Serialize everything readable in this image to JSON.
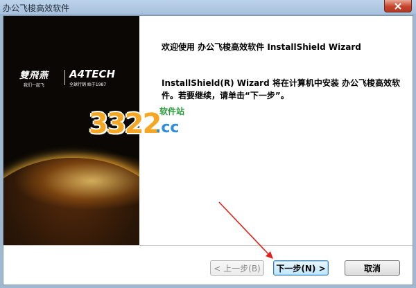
{
  "window": {
    "title": "办公飞梭高效软件"
  },
  "banner": {
    "brand_cn": "雙飛燕",
    "brand_cn_sub": "我们一起飞",
    "brand_en": "A4TECH",
    "brand_en_sub": "全球行销  始于1987"
  },
  "content": {
    "heading": "欢迎使用 办公飞梭高效软件 InstallShield Wizard",
    "body": "InstallShield(R) Wizard 将在计算机中安装 办公飞梭高效软件。若要继续，请单击“下一步”。"
  },
  "watermark": {
    "number": "3322",
    "suffix": ".cc",
    "site_label": "软件站"
  },
  "buttons": {
    "back": "< 上一步(B)",
    "next": "下一步(N) >",
    "cancel": "取消"
  },
  "colors": {
    "arrow": "#e0211b",
    "title_bar": "#b7cde4",
    "next_button_border": "#3c7fb1"
  }
}
